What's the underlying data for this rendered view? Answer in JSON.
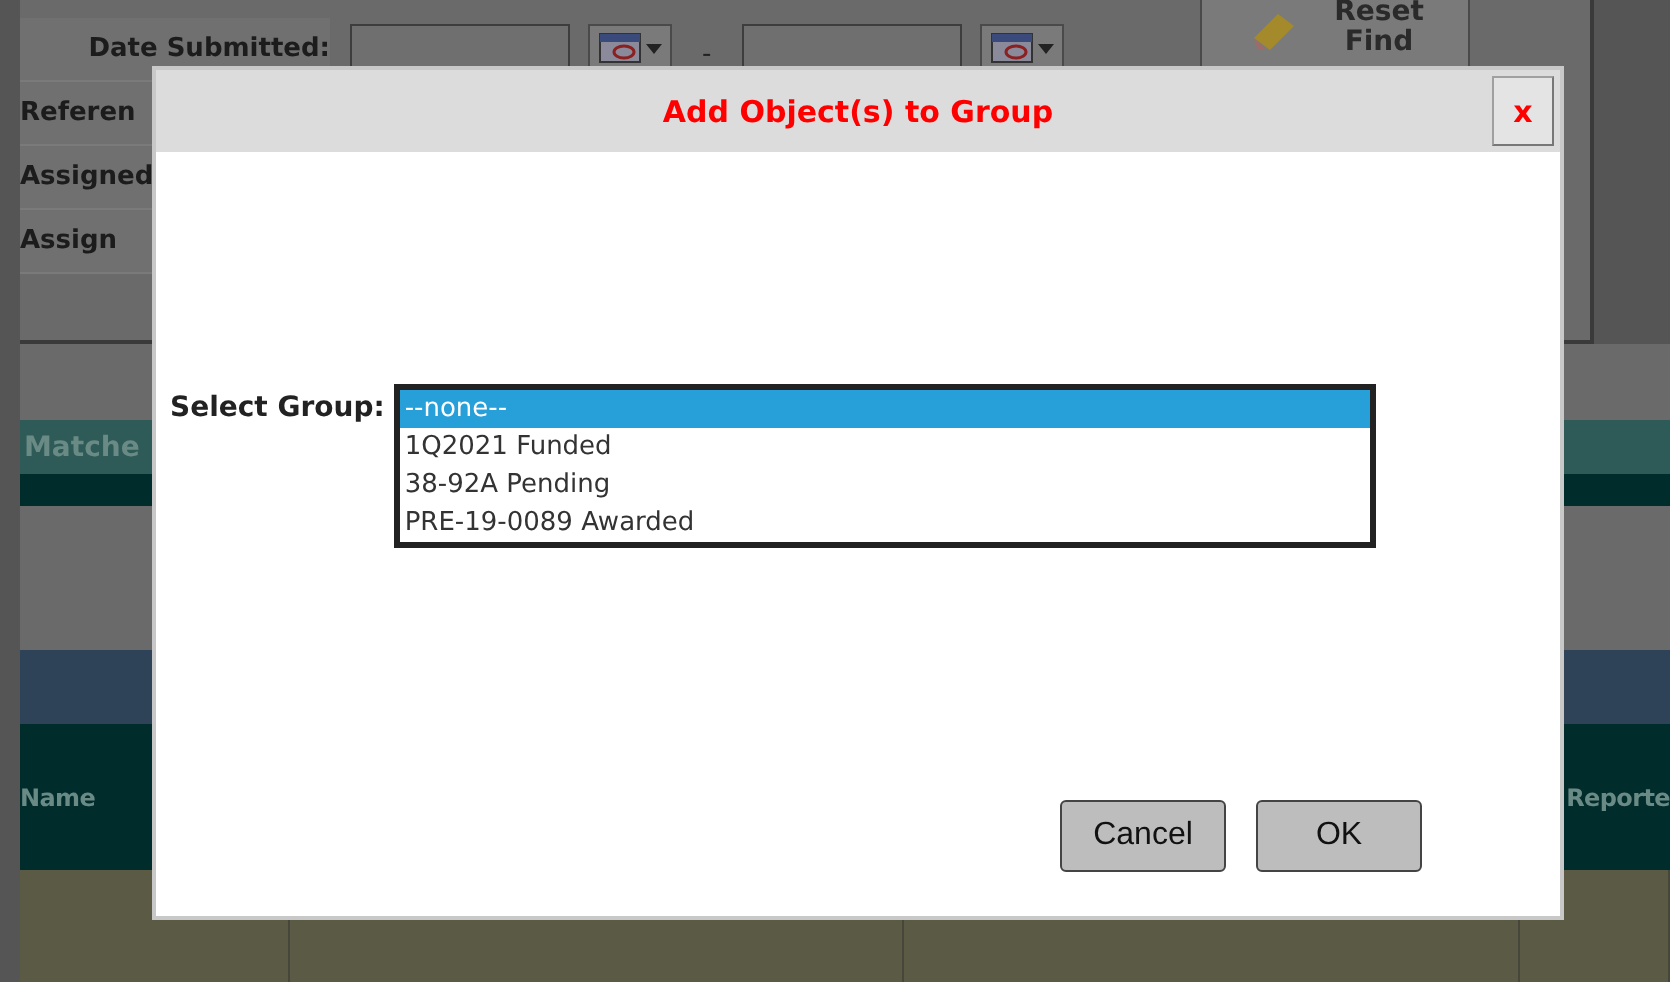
{
  "background_page": {
    "filter_labels": [
      "Date Submitted:",
      "Referen",
      "Assigned",
      "Assign"
    ],
    "date_separator": "-",
    "reset_button": {
      "line_1": "Reset",
      "line_2": "Find"
    },
    "matches_tab": "Matche",
    "columns": [
      "Name",
      "Reporte"
    ]
  },
  "dialog": {
    "title": "Add Object(s) to Group",
    "close": "x",
    "field_label": "Select Group:",
    "options": [
      {
        "label": "--none--",
        "selected": true
      },
      {
        "label": "1Q2021 Funded",
        "selected": false
      },
      {
        "label": "38-92A Pending",
        "selected": false
      },
      {
        "label": "PRE-19-0089 Awarded",
        "selected": false
      }
    ],
    "buttons": [
      "Cancel",
      "OK"
    ]
  }
}
